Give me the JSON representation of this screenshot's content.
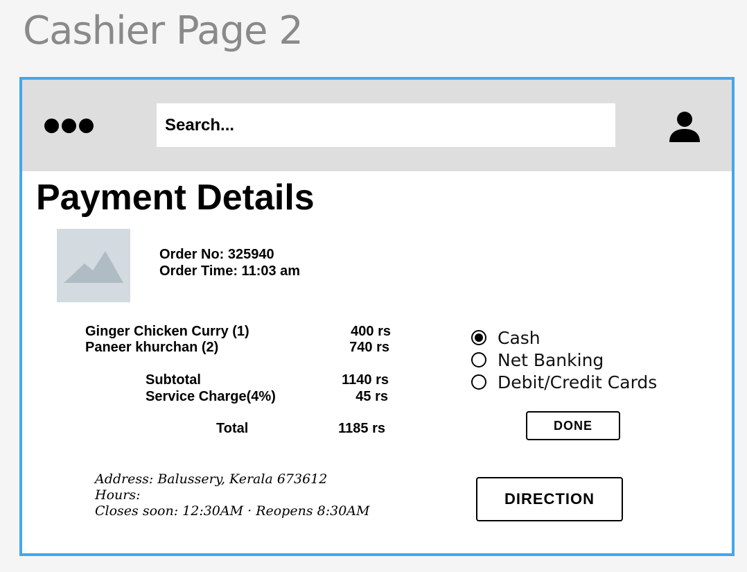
{
  "page_title": "Cashier Page 2",
  "header": {
    "menu_icon": "more-dots-icon",
    "search_placeholder": "Search...",
    "user_icon": "user-icon"
  },
  "main": {
    "heading": "Payment Details",
    "image_placeholder_icon": "image-placeholder-icon",
    "order_no": "Order No: 325940",
    "order_time": "Order Time: 11:03 am",
    "items": [
      {
        "name": "Ginger Chicken Curry (1)",
        "price": "400 rs"
      },
      {
        "name": "Paneer khurchan (2)",
        "price": "740 rs"
      }
    ],
    "subtotal_label": "Subtotal",
    "subtotal_value": "1140 rs",
    "service_label": "Service Charge(4%)",
    "service_value": "45 rs",
    "total_label": "Total",
    "total_value": "1185 rs",
    "payment_options": [
      {
        "label": "Cash",
        "selected": true
      },
      {
        "label": "Net Banking",
        "selected": false
      },
      {
        "label": "Debit/Credit Cards",
        "selected": false
      }
    ],
    "done_label": "DONE",
    "direction_label": "DIRECTION",
    "address": "Address: Balussery, Kerala 673612",
    "hours_label": "Hours:",
    "hours_text": "Closes soon: 12:30AM · Reopens 8:30AM"
  },
  "colors": {
    "frame_border": "#44a6ec",
    "topbar_bg": "#dedede",
    "image_placeholder_bg": "#d3dbe0"
  }
}
